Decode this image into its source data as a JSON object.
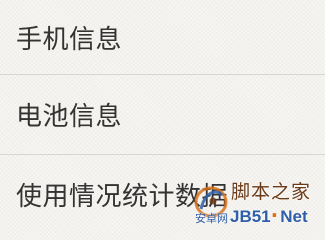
{
  "menu": {
    "items": [
      {
        "label": "手机信息"
      },
      {
        "label": "电池信息"
      },
      {
        "label": "使用情况统计数据"
      }
    ]
  },
  "watermark": {
    "top_text": "脚本之家",
    "site_text": "安卓网",
    "domain_text": "JB51",
    "dot_text": "·",
    "tld_text": "Net",
    "logo_icon": "jb51-logo-icon",
    "colors": {
      "brown": "#6a3a18",
      "blue": "#2f5fa8",
      "orange": "#d9741c"
    }
  },
  "colors": {
    "background": "#f4f2ee",
    "text": "#333333",
    "divider": "#d8d6d2"
  }
}
